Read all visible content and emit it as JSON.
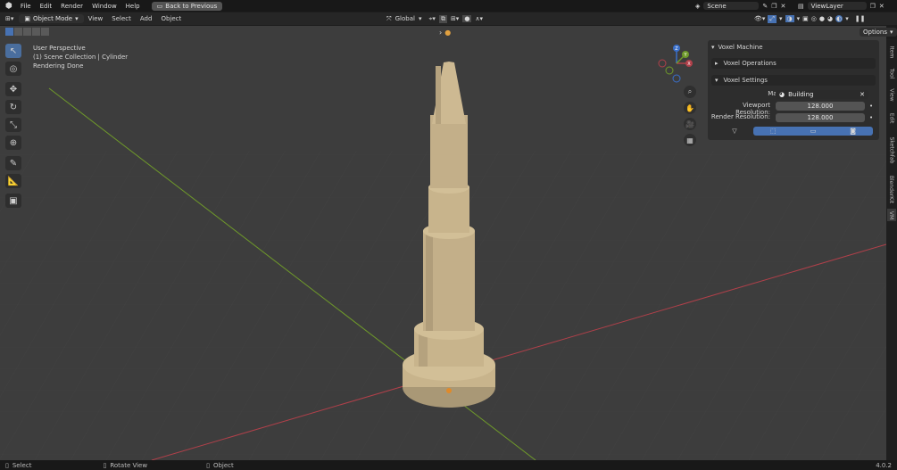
{
  "topbar": {
    "menus": [
      "File",
      "Edit",
      "Render",
      "Window",
      "Help"
    ],
    "back_button": "Back to Previous",
    "scene": "Scene",
    "view_layer": "ViewLayer"
  },
  "header": {
    "mode": "Object Mode",
    "menus": [
      "View",
      "Select",
      "Add",
      "Object"
    ],
    "orientation": "Global"
  },
  "subbar": {
    "options": "Options"
  },
  "viewport": {
    "overlay_lines": [
      "User Perspective",
      "(1) Scene Collection | Cylinder",
      "Rendering Done"
    ]
  },
  "gizmo": {
    "x": "X",
    "y": "Y",
    "z": "Z"
  },
  "panel": {
    "title": "Voxel Machine",
    "voxel_operations": "Voxel Operations",
    "voxel_settings": "Voxel Settings",
    "material_label": "Material:",
    "material_value": "Building",
    "viewport_res_label": "Viewport Resolution:",
    "viewport_res_value": "128.000",
    "render_res_label": "Render Resolution:",
    "render_res_value": "128.000"
  },
  "sidetabs": [
    "Item",
    "Tool",
    "View",
    "Edit",
    "Sketchfab",
    "BlenderKit",
    "VM"
  ],
  "statusbar": {
    "select": "Select",
    "rotate": "Rotate View",
    "object": "Object",
    "version": "4.0.2"
  },
  "colors": {
    "accent": "#4772b3",
    "axis_x": "#b0404a",
    "axis_y": "#6f9a2a",
    "model": "#c8b48c"
  }
}
